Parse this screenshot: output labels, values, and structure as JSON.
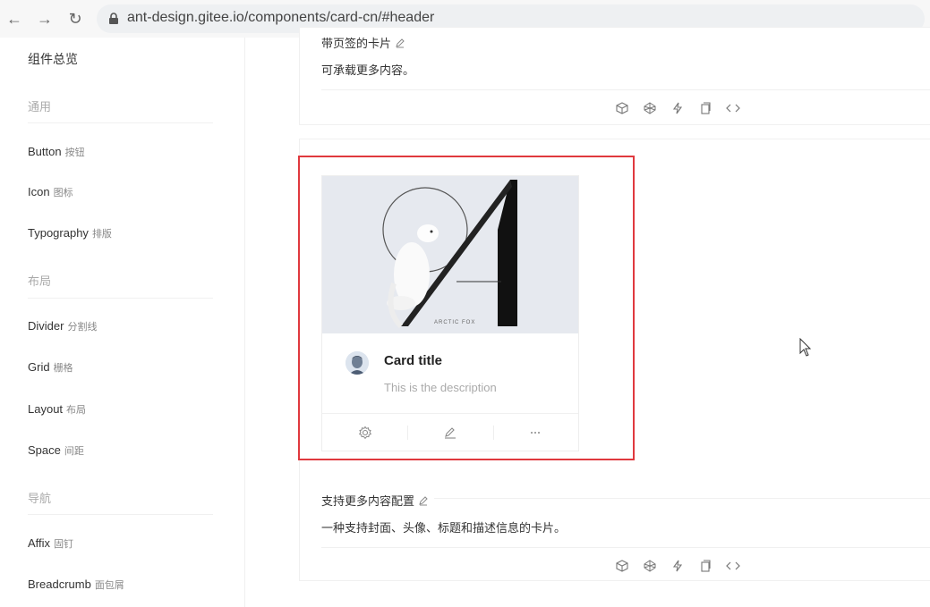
{
  "browser": {
    "url": "ant-design.gitee.io/components/card-cn/#header"
  },
  "sidebar": {
    "overview": "组件总览",
    "groups": [
      {
        "label": "通用"
      },
      {
        "label": "布局"
      },
      {
        "label": "导航"
      }
    ],
    "items": [
      {
        "en": "Button",
        "zh": "按钮"
      },
      {
        "en": "Icon",
        "zh": "图标"
      },
      {
        "en": "Typography",
        "zh": "排版"
      },
      {
        "en": "Divider",
        "zh": "分割线"
      },
      {
        "en": "Grid",
        "zh": "栅格"
      },
      {
        "en": "Layout",
        "zh": "布局"
      },
      {
        "en": "Space",
        "zh": "间距"
      },
      {
        "en": "Affix",
        "zh": "固钉"
      },
      {
        "en": "Breadcrumb",
        "zh": "面包屑"
      }
    ]
  },
  "demos": [
    {
      "title": "带页签的卡片",
      "desc": "可承载更多内容。"
    },
    {
      "title": "支持更多内容配置",
      "desc": "一种支持封面、头像、标题和描述信息的卡片。"
    }
  ],
  "card": {
    "cover_caption": "ARCTIC FOX",
    "title": "Card title",
    "description": "This is the description",
    "actions": [
      {
        "icon": "setting-icon"
      },
      {
        "icon": "edit-icon"
      },
      {
        "icon": "ellipsis-icon"
      }
    ]
  },
  "demo_actions": [
    "codesandbox-icon",
    "codepen-icon",
    "riddle-icon",
    "copy-icon",
    "expand-code-icon"
  ],
  "colors": {
    "highlight": "#e0393e",
    "border": "#f0f0f0"
  }
}
